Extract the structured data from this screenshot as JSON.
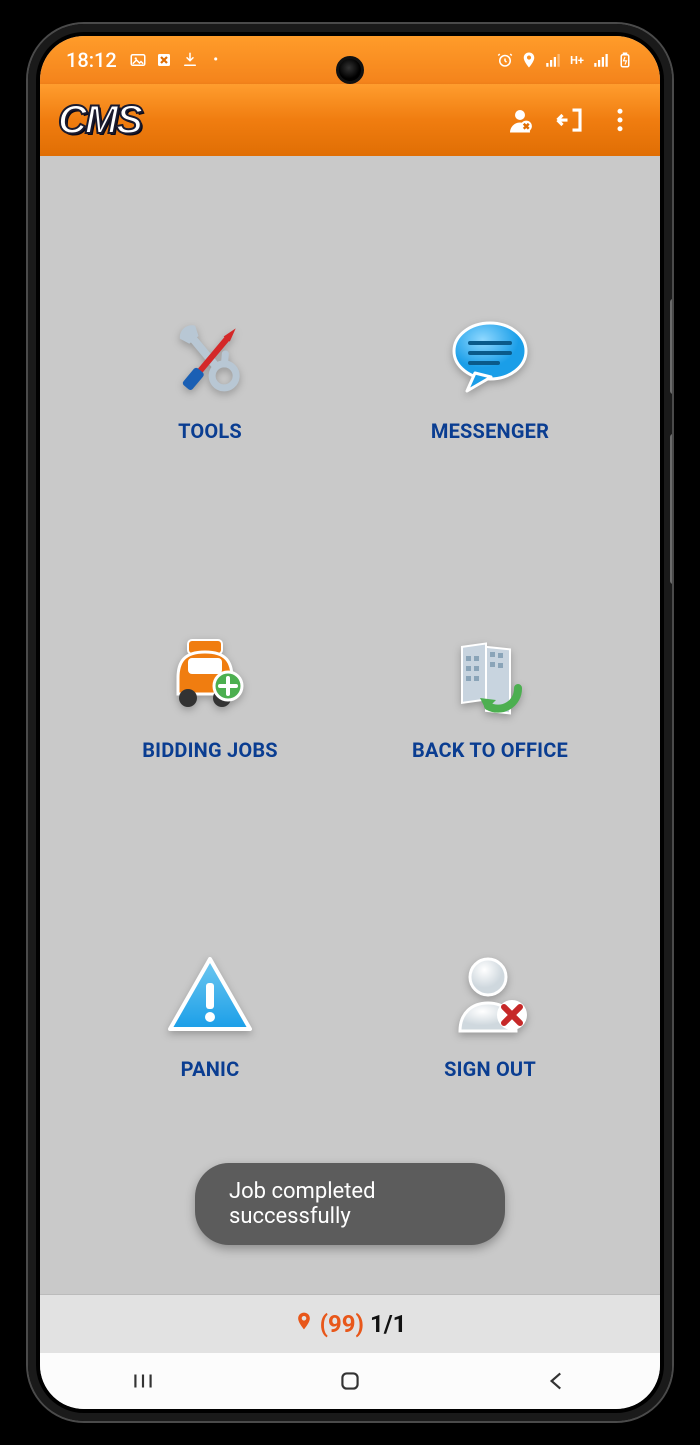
{
  "statusbar": {
    "time": "18:12",
    "left_icons": [
      "image-icon",
      "app-icon",
      "download-icon",
      "dot-icon"
    ],
    "right_icons": [
      "alarm-icon",
      "location-icon",
      "signal1-icon",
      "data-icon",
      "signal2-icon",
      "battery-icon"
    ]
  },
  "header": {
    "logo_text": "CMS",
    "actions": [
      {
        "name": "user-status-button",
        "icon": "user-x-icon"
      },
      {
        "name": "exit-button",
        "icon": "exit-icon"
      },
      {
        "name": "overflow-menu-button",
        "icon": "more-vert-icon"
      }
    ]
  },
  "tiles": [
    {
      "name": "tools-tile",
      "label": "TOOLS",
      "icon": "tools-icon"
    },
    {
      "name": "messenger-tile",
      "label": "MESSENGER",
      "icon": "chat-icon"
    },
    {
      "name": "bidding-jobs-tile",
      "label": "BIDDING JOBS",
      "icon": "car-plus-icon"
    },
    {
      "name": "back-to-office-tile",
      "label": "BACK TO OFFICE",
      "icon": "building-return-icon"
    },
    {
      "name": "panic-tile",
      "label": "PANIC",
      "icon": "warning-icon"
    },
    {
      "name": "sign-out-tile",
      "label": "SIGN OUT",
      "icon": "user-signout-icon"
    }
  ],
  "toast": {
    "message": "Job completed successfully"
  },
  "bottom": {
    "count": "(99)",
    "page": "1/1"
  },
  "colors": {
    "accent": "#f4831b",
    "label": "#0a3d91",
    "toast_bg": "#5c5c5c"
  }
}
